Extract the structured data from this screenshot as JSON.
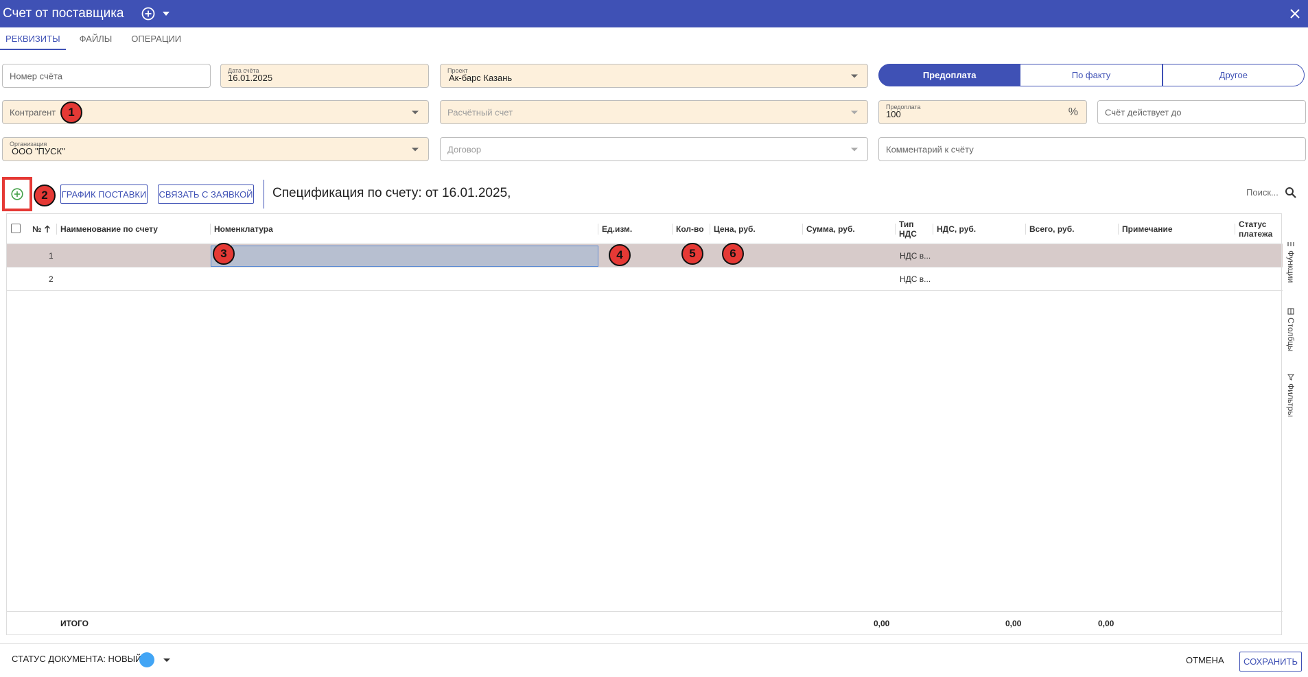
{
  "window": {
    "title": "Счет от поставщика"
  },
  "tabs": [
    {
      "label": "РЕКВИЗИТЫ"
    },
    {
      "label": "ФАЙЛЫ"
    },
    {
      "label": "ОПЕРАЦИИ"
    }
  ],
  "form": {
    "invoice_number": {
      "placeholder": "Номер счёта"
    },
    "invoice_date": {
      "label": "Дата счёта",
      "value": "16.01.2025"
    },
    "project": {
      "label": "Проект",
      "value": "Ак-барс Казань"
    },
    "payment_type": {
      "options": [
        "Предоплата",
        "По факту",
        "Другое"
      ],
      "selected": "Предоплата"
    },
    "counterparty": {
      "placeholder": "Контрагент"
    },
    "account": {
      "placeholder": "Расчётный счет"
    },
    "prepayment": {
      "label": "Предоплата",
      "value": "100",
      "unit": "%"
    },
    "valid_until": {
      "placeholder": "Счёт действует до"
    },
    "organization": {
      "label": "Организация",
      "value": "ООО \"ПУСК\""
    },
    "contract": {
      "placeholder": "Договор"
    },
    "comment": {
      "placeholder": "Комментарий к счёту"
    }
  },
  "markers": [
    "1",
    "2",
    "3",
    "4",
    "5",
    "6"
  ],
  "toolbar": {
    "schedule_label": "ГРАФИК ПОСТАВКИ",
    "link_label": "СВЯЗАТЬ С ЗАЯВКОЙ",
    "spec_title": "Спецификация по счету: от 16.01.2025,",
    "search_placeholder": "Поиск..."
  },
  "grid": {
    "columns": {
      "num": "№",
      "name_on_invoice": "Наименование по счету",
      "nomenclature": "Номенклатура",
      "unit": "Ед.изм.",
      "qty": "Кол-во",
      "price": "Цена, руб.",
      "sum": "Сумма, руб.",
      "vat_type_1": "Тип",
      "vat_type_2": "НДС",
      "vat": "НДС, руб.",
      "total": "Всего, руб.",
      "note": "Примечание",
      "pay_status_1": "Статус",
      "pay_status_2": "платежа"
    },
    "rows": [
      {
        "num": "1",
        "vat_type": "НДС в..."
      },
      {
        "num": "2",
        "vat_type": "НДС в..."
      }
    ],
    "footer": {
      "label": "ИТОГО",
      "sum": "0,00",
      "vat": "0,00",
      "total": "0,00"
    }
  },
  "side_panel": [
    "Функции",
    "Столбцы",
    "Фильтры"
  ],
  "status_bar": {
    "status_label": "СТАТУС ДОКУМЕНТА: НОВЫЙ",
    "status_color": "#42a5f5",
    "cancel_label": "ОТМЕНА",
    "save_label": "СОХРАНИТЬ"
  },
  "colors": {
    "primary": "#3f51b5",
    "required_bg": "#fdf0dc",
    "marker": "#e53935",
    "selected_row": "#d7cbca"
  }
}
